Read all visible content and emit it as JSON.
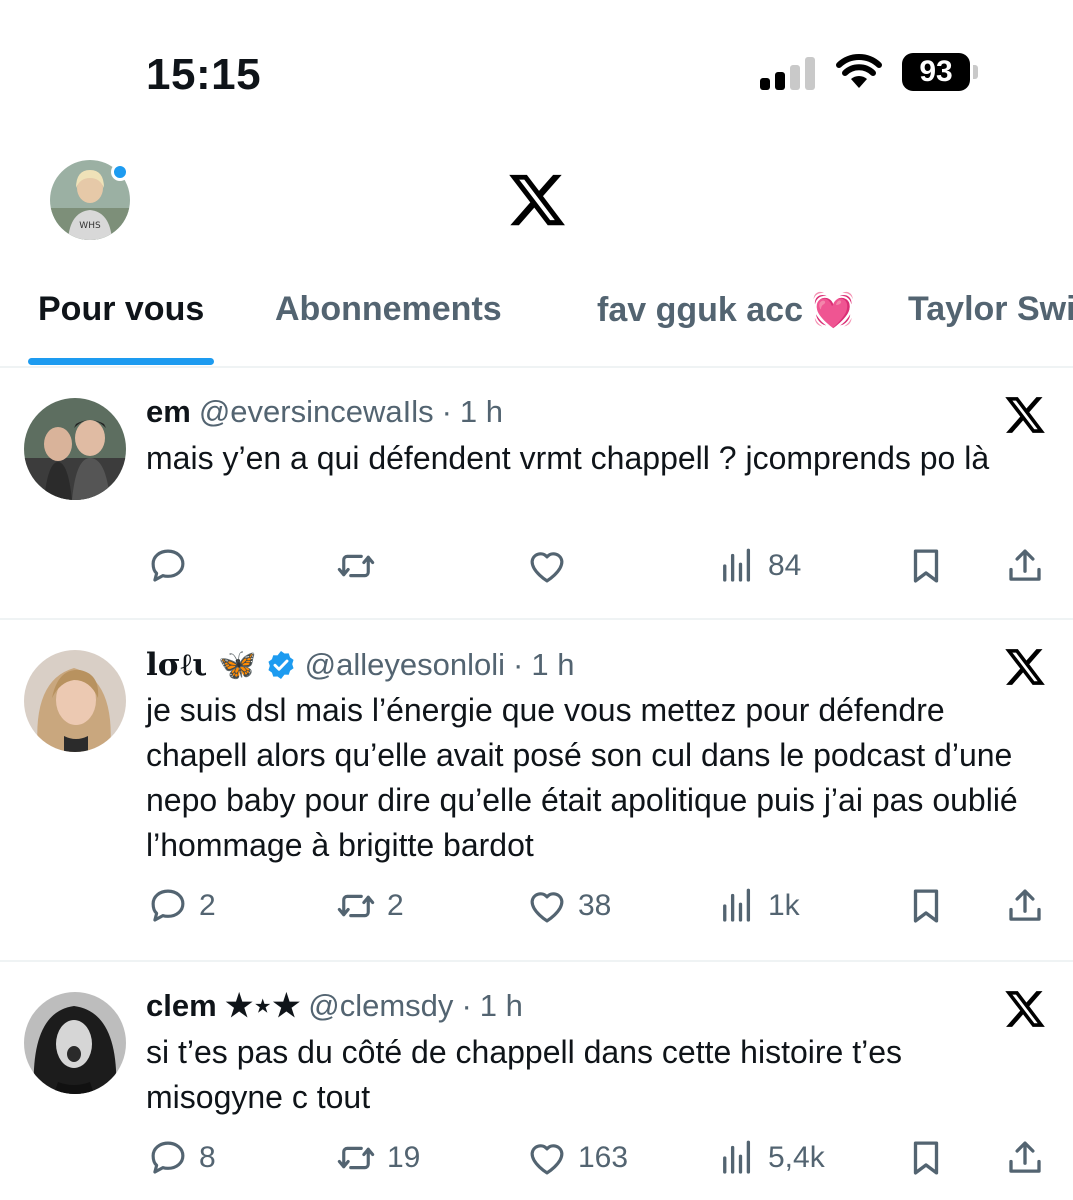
{
  "status": {
    "time": "15:15",
    "battery": "93"
  },
  "tabs": [
    {
      "label": "Pour vous",
      "active": true
    },
    {
      "label": "Abonnements"
    },
    {
      "label": "fav gguk acc 💓"
    },
    {
      "label": "Taylor Swi"
    }
  ],
  "tweets": [
    {
      "name": "em",
      "handle": "@eversincewaIls",
      "dot": "·",
      "time": "1 h",
      "text": "mais y’en a qui défendent vrmt chappell ? jcomprends po là",
      "replies": "",
      "retweets": "",
      "likes": "",
      "views": "84"
    },
    {
      "name": "lσℓι 🦋",
      "handle": "@alleyesonloli",
      "dot": "·",
      "time": "1 h",
      "verified": true,
      "text": "je suis dsl mais l’énergie que vous mettez pour défendre chapell alors qu’elle avait posé son cul dans le podcast d’une nepo baby pour dire qu’elle était apolitique puis j’ai pas oublié l’hommage à brigitte bardot",
      "replies": "2",
      "retweets": "2",
      "likes": "38",
      "views": "1k"
    },
    {
      "name": "clem ★⋆★",
      "handle": "@clemsdy",
      "dot": "·",
      "time": "1 h",
      "text": "si t’es pas du côté de chappell dans cette histoire t’es misogyne c tout",
      "replies": "8",
      "retweets": "19",
      "likes": "163",
      "views": "5,4k"
    }
  ],
  "colors": {
    "accent": "#1d9bf0",
    "text": "#0f1419",
    "muted": "#536471"
  }
}
